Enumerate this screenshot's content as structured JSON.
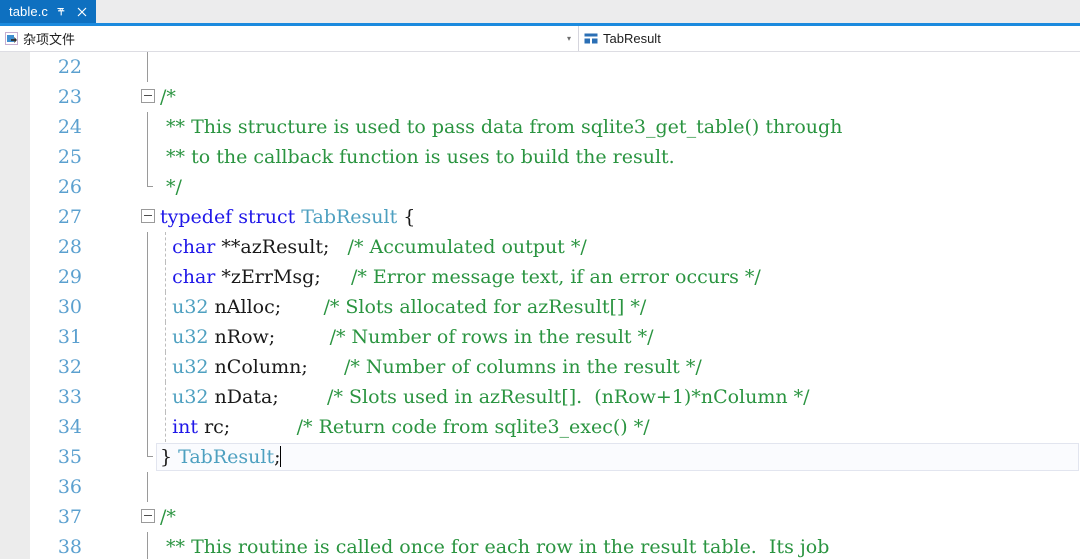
{
  "window": {
    "accent_color": "#0e70c0",
    "tabstrip_underline_color": "#1b8ade"
  },
  "tab": {
    "title": "table.c",
    "pin_icon": "pin-icon",
    "close_icon": "close-icon"
  },
  "nav_bar": {
    "project_combo": {
      "icon": "misc-file-icon",
      "value": "杂项文件",
      "arrow": "▾"
    },
    "member_combo": {
      "icon": "struct-icon",
      "value": "TabResult"
    }
  },
  "editor": {
    "caret_line": 35,
    "colors": {
      "comment": "#2a9440",
      "keyword": "#1f17e8",
      "type": "#4ea0c0",
      "plain": "#1a1a1a",
      "line_number": "#5ba0cf",
      "margin": "#ececec"
    },
    "lines": [
      {
        "num": "22",
        "fold": "none",
        "guide": "full",
        "indent": false,
        "tokens": []
      },
      {
        "num": "23",
        "fold": "minus",
        "guide": "none",
        "indent": false,
        "tokens": [
          {
            "t": "/*",
            "c": "comment"
          }
        ]
      },
      {
        "num": "24",
        "fold": "none",
        "guide": "full",
        "indent": false,
        "tokens": [
          {
            "t": " ** This structure is used to pass data from sqlite3_get_table() through",
            "c": "comment"
          }
        ]
      },
      {
        "num": "25",
        "fold": "none",
        "guide": "full",
        "indent": false,
        "tokens": [
          {
            "t": " ** to the callback function is uses to build the result.",
            "c": "comment"
          }
        ]
      },
      {
        "num": "26",
        "fold": "none",
        "guide": "elbow",
        "indent": false,
        "tokens": [
          {
            "t": " */",
            "c": "comment"
          }
        ]
      },
      {
        "num": "27",
        "fold": "minus",
        "guide": "none",
        "indent": false,
        "tokens": [
          {
            "t": "typedef",
            "c": "keyword"
          },
          {
            "t": " ",
            "c": "plain"
          },
          {
            "t": "struct",
            "c": "keyword"
          },
          {
            "t": " ",
            "c": "plain"
          },
          {
            "t": "TabResult",
            "c": "type"
          },
          {
            "t": " {",
            "c": "plain"
          }
        ]
      },
      {
        "num": "28",
        "fold": "none",
        "guide": "full",
        "indent": true,
        "tokens": [
          {
            "t": "  ",
            "c": "plain"
          },
          {
            "t": "char",
            "c": "keyword"
          },
          {
            "t": " **azResult;   ",
            "c": "plain"
          },
          {
            "t": "/* Accumulated output */",
            "c": "comment"
          }
        ]
      },
      {
        "num": "29",
        "fold": "none",
        "guide": "full",
        "indent": true,
        "tokens": [
          {
            "t": "  ",
            "c": "plain"
          },
          {
            "t": "char",
            "c": "keyword"
          },
          {
            "t": " *zErrMsg;     ",
            "c": "plain"
          },
          {
            "t": "/* Error message text, if an error occurs */",
            "c": "comment"
          }
        ]
      },
      {
        "num": "30",
        "fold": "none",
        "guide": "full",
        "indent": true,
        "tokens": [
          {
            "t": "  ",
            "c": "plain"
          },
          {
            "t": "u32",
            "c": "type"
          },
          {
            "t": " nAlloc;       ",
            "c": "plain"
          },
          {
            "t": "/* Slots allocated for azResult[] */",
            "c": "comment"
          }
        ]
      },
      {
        "num": "31",
        "fold": "none",
        "guide": "full",
        "indent": true,
        "tokens": [
          {
            "t": "  ",
            "c": "plain"
          },
          {
            "t": "u32",
            "c": "type"
          },
          {
            "t": " nRow;         ",
            "c": "plain"
          },
          {
            "t": "/* Number of rows in the result */",
            "c": "comment"
          }
        ]
      },
      {
        "num": "32",
        "fold": "none",
        "guide": "full",
        "indent": true,
        "tokens": [
          {
            "t": "  ",
            "c": "plain"
          },
          {
            "t": "u32",
            "c": "type"
          },
          {
            "t": " nColumn;      ",
            "c": "plain"
          },
          {
            "t": "/* Number of columns in the result */",
            "c": "comment"
          }
        ]
      },
      {
        "num": "33",
        "fold": "none",
        "guide": "full",
        "indent": true,
        "tokens": [
          {
            "t": "  ",
            "c": "plain"
          },
          {
            "t": "u32",
            "c": "type"
          },
          {
            "t": " nData;        ",
            "c": "plain"
          },
          {
            "t": "/* Slots used in azResult[].  (nRow+1)*nColumn */",
            "c": "comment"
          }
        ]
      },
      {
        "num": "34",
        "fold": "none",
        "guide": "full",
        "indent": true,
        "tokens": [
          {
            "t": "  ",
            "c": "plain"
          },
          {
            "t": "int",
            "c": "keyword"
          },
          {
            "t": " rc;           ",
            "c": "plain"
          },
          {
            "t": "/* Return code from sqlite3_exec() */",
            "c": "comment"
          }
        ]
      },
      {
        "num": "35",
        "fold": "none",
        "guide": "elbow",
        "indent": false,
        "current": true,
        "tokens": [
          {
            "t": "} ",
            "c": "plain"
          },
          {
            "t": "TabResult",
            "c": "type"
          },
          {
            "t": ";",
            "c": "plain"
          }
        ]
      },
      {
        "num": "36",
        "fold": "none",
        "guide": "full",
        "indent": false,
        "tokens": []
      },
      {
        "num": "37",
        "fold": "minus",
        "guide": "none",
        "indent": false,
        "tokens": [
          {
            "t": "/*",
            "c": "comment"
          }
        ]
      },
      {
        "num": "38",
        "fold": "none",
        "guide": "full",
        "indent": false,
        "tokens": [
          {
            "t": " ** This routine is called once for each row in the result table.  Its job",
            "c": "comment"
          }
        ]
      }
    ]
  }
}
